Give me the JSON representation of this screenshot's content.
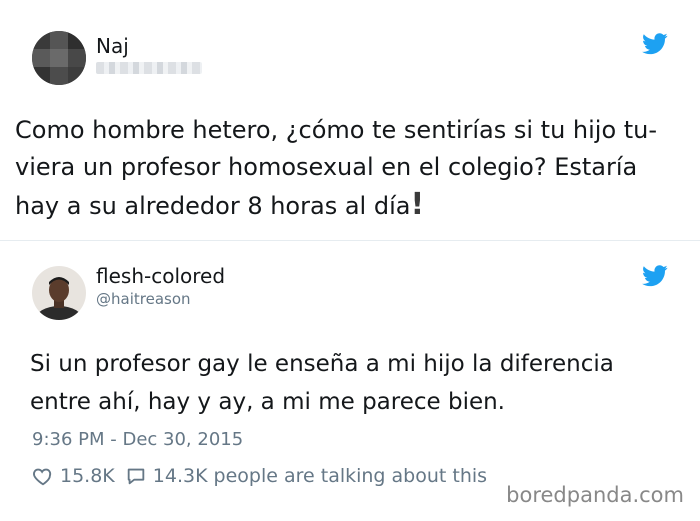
{
  "tweet1": {
    "name": "Naj",
    "lines": [
      "Como hombre hetero, ¿cómo te sentirías si tu hijo tu-",
      "viera un profesor homosexual en el colegio? Estaría",
      "hay a su alrededor 8 horas al día"
    ],
    "exclamation": "!"
  },
  "tweet2": {
    "name": "flesh-colored",
    "handle": "@haitreason",
    "lines": [
      "Si un profesor gay le enseña a mi hijo la diferencia",
      "entre ahí, hay y ay, a mi me parece bien."
    ],
    "timestamp": "9:36 PM - Dec 30, 2015",
    "likes": "15.8K",
    "replies": "14.3K",
    "talking": "people are talking about this"
  },
  "watermark": "boredpanda.com",
  "colors": {
    "twitter_blue": "#1da1f2",
    "text": "#14171a",
    "secondary": "#657786"
  },
  "icons": {
    "bird": "twitter-bird-icon",
    "heart": "heart-icon",
    "reply": "reply-bubble-icon"
  }
}
